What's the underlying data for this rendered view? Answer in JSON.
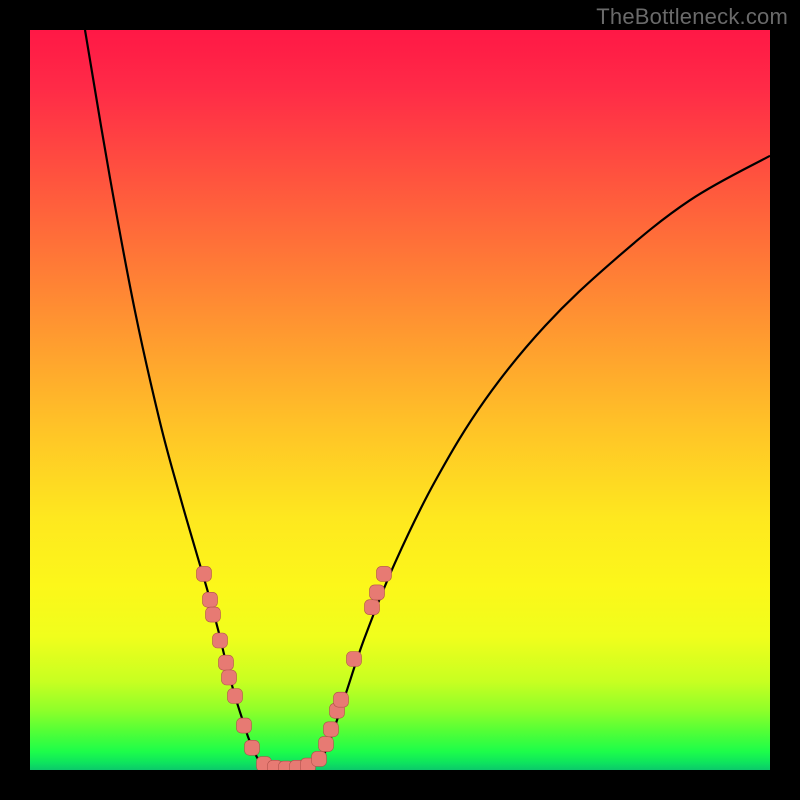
{
  "watermark": "TheBottleneck.com",
  "colors": {
    "frame": "#000000",
    "curve": "#000000",
    "marker_fill": "#e77a73",
    "marker_stroke": "#b1524c",
    "gradient_top": "#ff1846",
    "gradient_bottom": "#0cc86b"
  },
  "chart_data": {
    "type": "line",
    "title": "",
    "xlabel": "",
    "ylabel": "",
    "x_range": [
      0,
      740
    ],
    "y_range_pct": [
      0,
      100
    ],
    "note": "Y values are bottleneck percentage; 0% at bottom (green), 100% at top (red). X is unlabeled component-scale axis. Curve values read off gradient position.",
    "series": [
      {
        "name": "left-curve",
        "x": [
          55,
          80,
          105,
          130,
          150,
          165,
          178,
          188,
          197,
          205,
          212,
          218,
          224,
          230
        ],
        "y_pct": [
          100,
          80,
          62,
          47,
          37,
          30,
          24,
          19,
          14,
          10,
          7,
          4.5,
          2.5,
          1
        ]
      },
      {
        "name": "valley-floor",
        "x": [
          230,
          240,
          250,
          260,
          270,
          280,
          290
        ],
        "y_pct": [
          1,
          0.4,
          0.2,
          0.2,
          0.2,
          0.4,
          1
        ]
      },
      {
        "name": "right-curve",
        "x": [
          290,
          300,
          315,
          335,
          365,
          405,
          455,
          515,
          585,
          660,
          740
        ],
        "y_pct": [
          1,
          4,
          10,
          18,
          28,
          39,
          50,
          60,
          69,
          77,
          83
        ]
      }
    ],
    "markers": {
      "name": "highlighted-points",
      "points": [
        {
          "x": 174,
          "y_pct": 26.5
        },
        {
          "x": 180,
          "y_pct": 23
        },
        {
          "x": 183,
          "y_pct": 21
        },
        {
          "x": 190,
          "y_pct": 17.5
        },
        {
          "x": 196,
          "y_pct": 14.5
        },
        {
          "x": 199,
          "y_pct": 12.5
        },
        {
          "x": 205,
          "y_pct": 10
        },
        {
          "x": 214,
          "y_pct": 6
        },
        {
          "x": 222,
          "y_pct": 3
        },
        {
          "x": 234,
          "y_pct": 0.8
        },
        {
          "x": 245,
          "y_pct": 0.3
        },
        {
          "x": 256,
          "y_pct": 0.2
        },
        {
          "x": 267,
          "y_pct": 0.3
        },
        {
          "x": 278,
          "y_pct": 0.6
        },
        {
          "x": 289,
          "y_pct": 1.5
        },
        {
          "x": 296,
          "y_pct": 3.5
        },
        {
          "x": 301,
          "y_pct": 5.5
        },
        {
          "x": 307,
          "y_pct": 8
        },
        {
          "x": 311,
          "y_pct": 9.5
        },
        {
          "x": 324,
          "y_pct": 15
        },
        {
          "x": 342,
          "y_pct": 22
        },
        {
          "x": 347,
          "y_pct": 24
        },
        {
          "x": 354,
          "y_pct": 26.5
        }
      ]
    }
  }
}
